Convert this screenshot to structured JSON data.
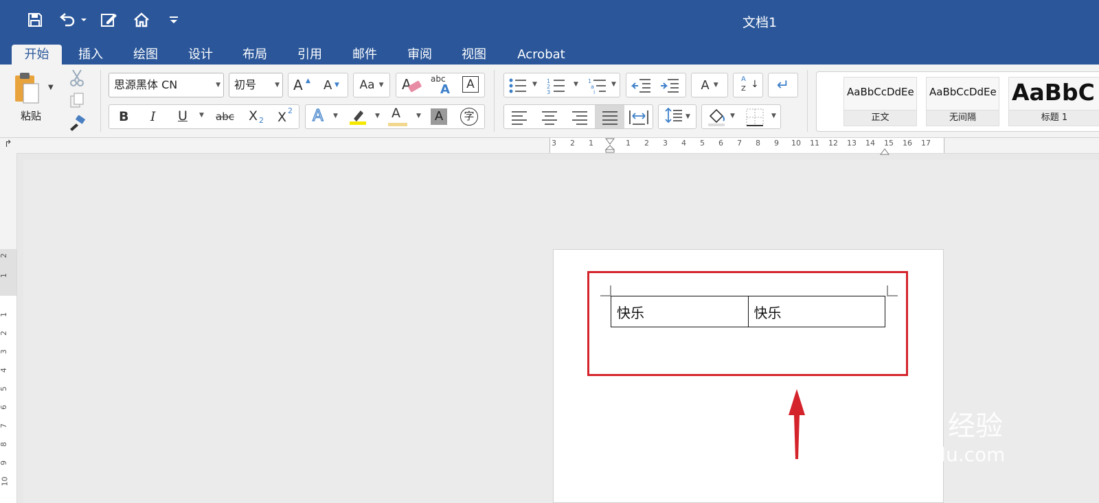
{
  "app": {
    "document_title": "文档1"
  },
  "tabs": [
    "开始",
    "插入",
    "绘图",
    "设计",
    "布局",
    "引用",
    "邮件",
    "审阅",
    "视图",
    "Acrobat"
  ],
  "clipboard": {
    "paste_label": "粘贴"
  },
  "font": {
    "family": "思源黑体 CN",
    "size": "初号",
    "bold": "B",
    "italic": "I",
    "underline": "U",
    "strikethrough": "abc",
    "subscript": "X",
    "subscript_mark": "2",
    "superscript": "X",
    "superscript_mark": "2",
    "grow": "A",
    "shrink": "A",
    "change_case": "Aa",
    "clear_format": "A",
    "phonetic": "abc",
    "phonetic_mark": "A",
    "char_border": "A",
    "text_effects": "A",
    "font_color": "A",
    "char_shading": "A",
    "enclose_char": "字"
  },
  "paragraph": {
    "sort_a": "A",
    "sort_z": "Z"
  },
  "styles": [
    {
      "sample": "AaBbCcDdEe",
      "name": "正文"
    },
    {
      "sample": "AaBbCcDdEe",
      "name": "无间隔"
    },
    {
      "sample": "AaBbC",
      "name": "标题 1"
    }
  ],
  "ruler": {
    "h_ticks": [
      "3",
      "2",
      "1",
      "1",
      "2",
      "3",
      "4",
      "5",
      "6",
      "7",
      "8",
      "9",
      "10",
      "11",
      "12",
      "13",
      "14",
      "15",
      "16",
      "17"
    ],
    "v_ticks": [
      "2",
      "1",
      "1",
      "2",
      "3",
      "4",
      "5",
      "6",
      "7",
      "8",
      "9",
      "10"
    ]
  },
  "document": {
    "table": [
      [
        "快乐",
        "快乐"
      ]
    ]
  },
  "watermark": {
    "brand": "Baidu",
    "product": "经验",
    "url": "jingyan.baidu.com"
  },
  "colors": {
    "title_bar": "#2b579a",
    "highlight_box": "#d4232b",
    "annotation_arrow": "#d4232b"
  }
}
